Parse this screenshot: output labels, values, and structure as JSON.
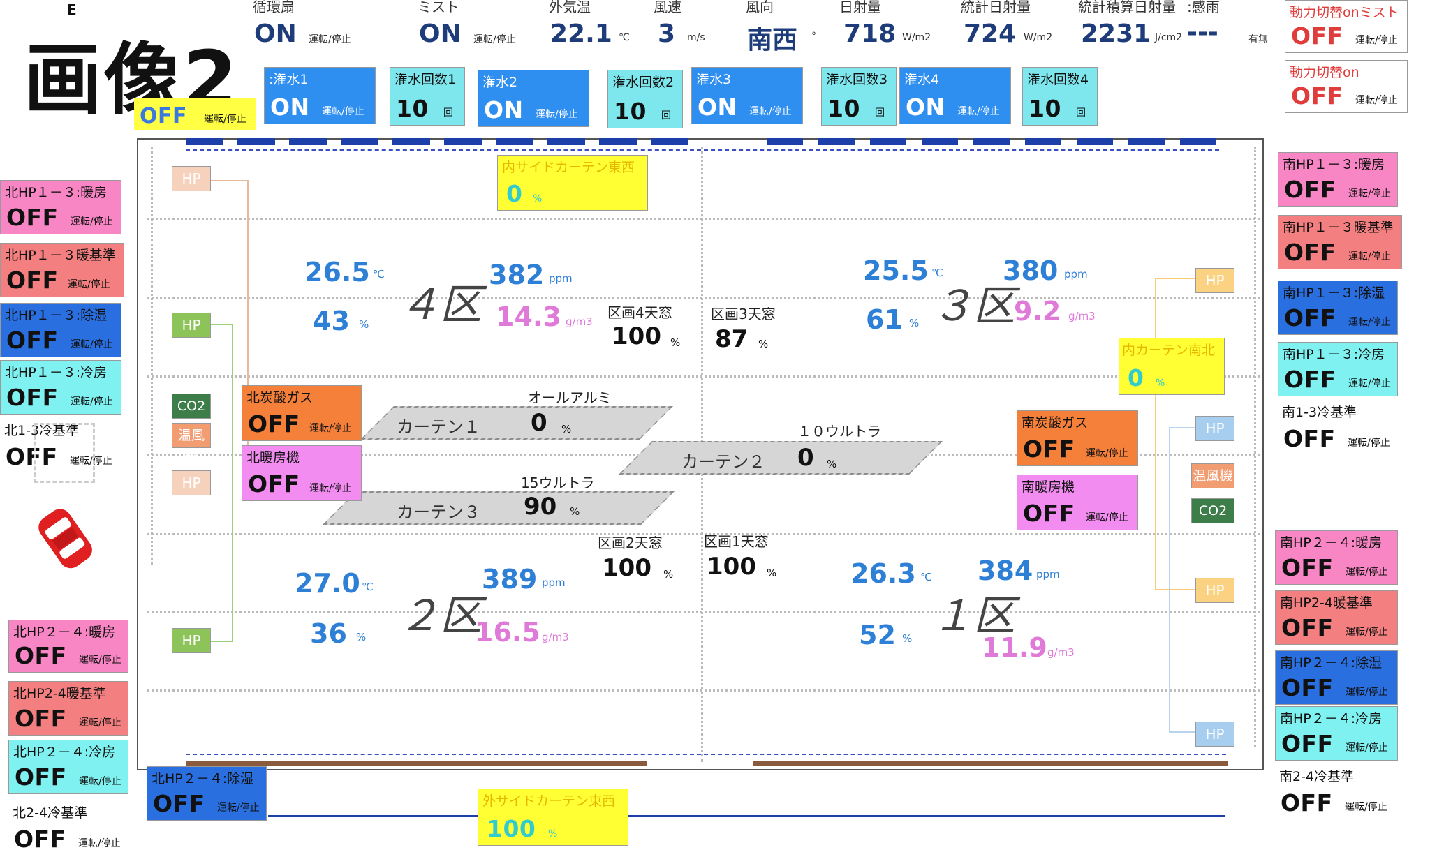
{
  "title": "画像2",
  "top_left_marker": "E",
  "weather": [
    {
      "label": "循環扇",
      "value": "ON",
      "unit": "運転/停止"
    },
    {
      "label": "ミスト",
      "value": "ON",
      "unit": "運転/停止"
    },
    {
      "label": "外気温",
      "value": "22.1",
      "unit": "℃"
    },
    {
      "label": "風速",
      "value": "3",
      "unit": "m/s"
    },
    {
      "label": "風向",
      "value": "南西",
      "unit": "°"
    },
    {
      "label": "日射量",
      "value": "718",
      "unit": "W/m2"
    },
    {
      "label": "統計日射量",
      "value": "724",
      "unit": "W/m2"
    },
    {
      "label": "統計積算日射量",
      "value": "2231",
      "unit": "J/cm2"
    },
    {
      "label": ":感雨",
      "value": "---",
      "unit": "有無"
    }
  ],
  "power_switch": [
    {
      "label": "動力切替onミスト",
      "value": "OFF",
      "unit": "運転/停止"
    },
    {
      "label": "動力切替on",
      "value": "OFF",
      "unit": "運転/停止"
    }
  ],
  "irrigation": {
    "partial_off": {
      "value": "OFF",
      "unit": "運転/停止"
    },
    "items": [
      {
        "label": ":潅水1",
        "value": "ON",
        "unit": "運転/停止"
      },
      {
        "label": "潅水回数1",
        "value": "10",
        "unit": "回"
      },
      {
        "label": "潅水2",
        "value": "ON",
        "unit": "運転/停止"
      },
      {
        "label": "潅水回数2",
        "value": "10",
        "unit": "回"
      },
      {
        "label": "潅水3",
        "value": "ON",
        "unit": "運転/停止"
      },
      {
        "label": "潅水回数3",
        "value": "10",
        "unit": "回"
      },
      {
        "label": "潅水4",
        "value": "ON",
        "unit": "運転/停止"
      },
      {
        "label": "潅水回数4",
        "value": "10",
        "unit": "回"
      }
    ]
  },
  "left_panel": [
    {
      "label": "北HP１－３:暖房",
      "value": "OFF",
      "unit": "運転/停止"
    },
    {
      "label": "北HP１－３暖基準",
      "value": "OFF",
      "unit": "運転/停止"
    },
    {
      "label": "北HP１－３:除湿",
      "value": "OFF",
      "unit": "運転/停止"
    },
    {
      "label": "北HP１－３:冷房",
      "value": "OFF",
      "unit": "運転/停止"
    },
    {
      "label": "北1-3冷基準",
      "value": "OFF",
      "unit": "運転/停止"
    },
    {
      "label": "北HP２－４:暖房",
      "value": "OFF",
      "unit": "運転/停止"
    },
    {
      "label": "北HP2-4暖基準",
      "value": "OFF",
      "unit": "運転/停止"
    },
    {
      "label": "北HP２－４:冷房",
      "value": "OFF",
      "unit": "運転/停止"
    },
    {
      "label": "北2-4冷基準",
      "value": "OFF",
      "unit": "運転/停止"
    },
    {
      "label": "北HP２－４:除湿",
      "value": "OFF",
      "unit": "運転/停止"
    }
  ],
  "right_panel": [
    {
      "label": "南HP１－３:暖房",
      "value": "OFF",
      "unit": "運転/停止"
    },
    {
      "label": "南HP１－３暖基準",
      "value": "OFF",
      "unit": "運転/停止"
    },
    {
      "label": "南HP１－３:除湿",
      "value": "OFF",
      "unit": "運転/停止"
    },
    {
      "label": "南HP１－３:冷房",
      "value": "OFF",
      "unit": "運転/停止"
    },
    {
      "label": "南1-3冷基準",
      "value": "OFF",
      "unit": "運転/停止"
    },
    {
      "label": "南HP２－４:暖房",
      "value": "OFF",
      "unit": "運転/停止"
    },
    {
      "label": "南HP2-4暖基準",
      "value": "OFF",
      "unit": "運転/停止"
    },
    {
      "label": "南HP２－４:除湿",
      "value": "OFF",
      "unit": "運転/停止"
    },
    {
      "label": "南HP２－４:冷房",
      "value": "OFF",
      "unit": "運転/停止"
    },
    {
      "label": "南2-4冷基準",
      "value": "OFF",
      "unit": "運転/停止"
    }
  ],
  "greenhouse": {
    "zones": {
      "z4": {
        "name": "４区",
        "temp": "26.5",
        "temp_unit": "℃",
        "co2": "382",
        "co2_unit": "ppm",
        "hum": "43",
        "hum_unit": "%",
        "hd": "14.3",
        "hd_unit": "g/m3"
      },
      "z3": {
        "name": "３区",
        "temp": "25.5",
        "temp_unit": "℃",
        "co2": "380",
        "co2_unit": "ppm",
        "hum": "61",
        "hum_unit": "%",
        "hd": "9.2",
        "hd_unit": "g/m3"
      },
      "z2": {
        "name": "２区",
        "temp": "27.0",
        "temp_unit": "℃",
        "co2": "389",
        "co2_unit": "ppm",
        "hum": "36",
        "hum_unit": "%",
        "hd": "16.5",
        "hd_unit": "g/m3"
      },
      "z1": {
        "name": "１区",
        "temp": "26.3",
        "temp_unit": "℃",
        "co2": "384",
        "co2_unit": "ppm",
        "hum": "52",
        "hum_unit": "%",
        "hd": "11.9",
        "hd_unit": "g/m3"
      }
    },
    "windows": {
      "w4": {
        "label": "区画4天窓",
        "value": "100",
        "unit": "%"
      },
      "w3": {
        "label": "区画3天窓",
        "value": "87",
        "unit": "%"
      },
      "w2": {
        "label": "区画2天窓",
        "value": "100",
        "unit": "%"
      },
      "w1": {
        "label": "区画1天窓",
        "value": "100",
        "unit": "%"
      }
    },
    "curtains": {
      "c1": {
        "type": "オールアルミ",
        "name": "カーテン１",
        "value": "0",
        "unit": "%"
      },
      "c2": {
        "type": "１０ウルトラ",
        "name": "カーテン２",
        "value": "0",
        "unit": "%"
      },
      "c3": {
        "type": "15ウルトラ",
        "name": "カーテン３",
        "value": "90",
        "unit": "%"
      }
    },
    "inner_side_ew": {
      "label": "内サイドカーテン東西",
      "value": "0",
      "unit": "%"
    },
    "inner_ns": {
      "label": "内カーテン南北",
      "value": "0",
      "unit": "%"
    },
    "outer_side_ew": {
      "label": "外サイドカーテン東西",
      "value": "100",
      "unit": "%"
    },
    "north_co2_gas": {
      "label": "北炭酸ガス",
      "value": "OFF",
      "unit": "運転/停止"
    },
    "north_heater": {
      "label": "北暖房機",
      "value": "OFF",
      "unit": "運転/停止"
    },
    "south_co2_gas": {
      "label": "南炭酸ガス",
      "value": "OFF",
      "unit": "運転/停止"
    },
    "south_heater": {
      "label": "南暖房機",
      "value": "OFF",
      "unit": "運転/停止"
    },
    "equip": {
      "hp": "HP",
      "co2": "CO2",
      "heater": "温風機"
    }
  },
  "colors": {
    "pink": "#f986c4",
    "salmon": "#f47f80",
    "blue": "#2a6fe0",
    "cyan": "#7ff1f1",
    "yellow": "#ffff33",
    "orange": "#f5803a",
    "magenta": "#f28cf0",
    "light_blue": "#2f8ff0",
    "light_cyan": "#7ee7ee",
    "hp_green": "#8cc45a",
    "hp_peach": "#f5c9b0",
    "hp_light_orange": "#fbd281",
    "hp_light_blue": "#a7cdef",
    "co2_dark_green": "#3d7d4a",
    "heater_orange": "#f29c72"
  }
}
